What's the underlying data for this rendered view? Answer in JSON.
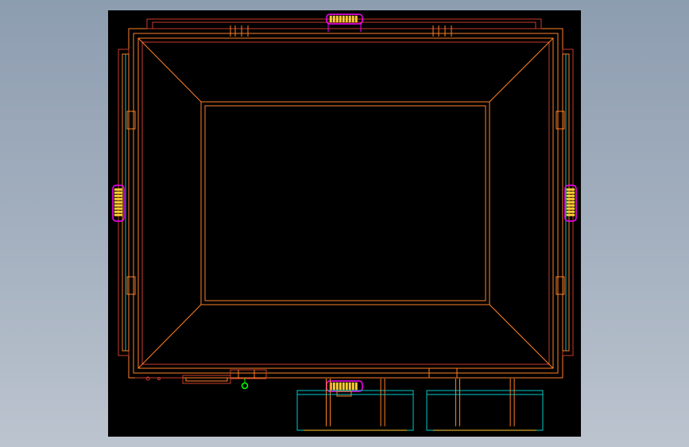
{
  "colors": {
    "background_gradient_top": "#8d9db0",
    "background_gradient_bottom": "#bcc4cf",
    "viewport_background": "#000000",
    "primary_outline": "#ff7f27",
    "secondary_outline": "#c83c2c",
    "handle_outline": "#ff00ff",
    "handle_fill": "#ffcc33",
    "detail_outline": "#00c8c8",
    "marker": "#00ff00"
  },
  "icons": {
    "handles": "grip-handle-icon",
    "marker": "origin-marker-icon"
  }
}
